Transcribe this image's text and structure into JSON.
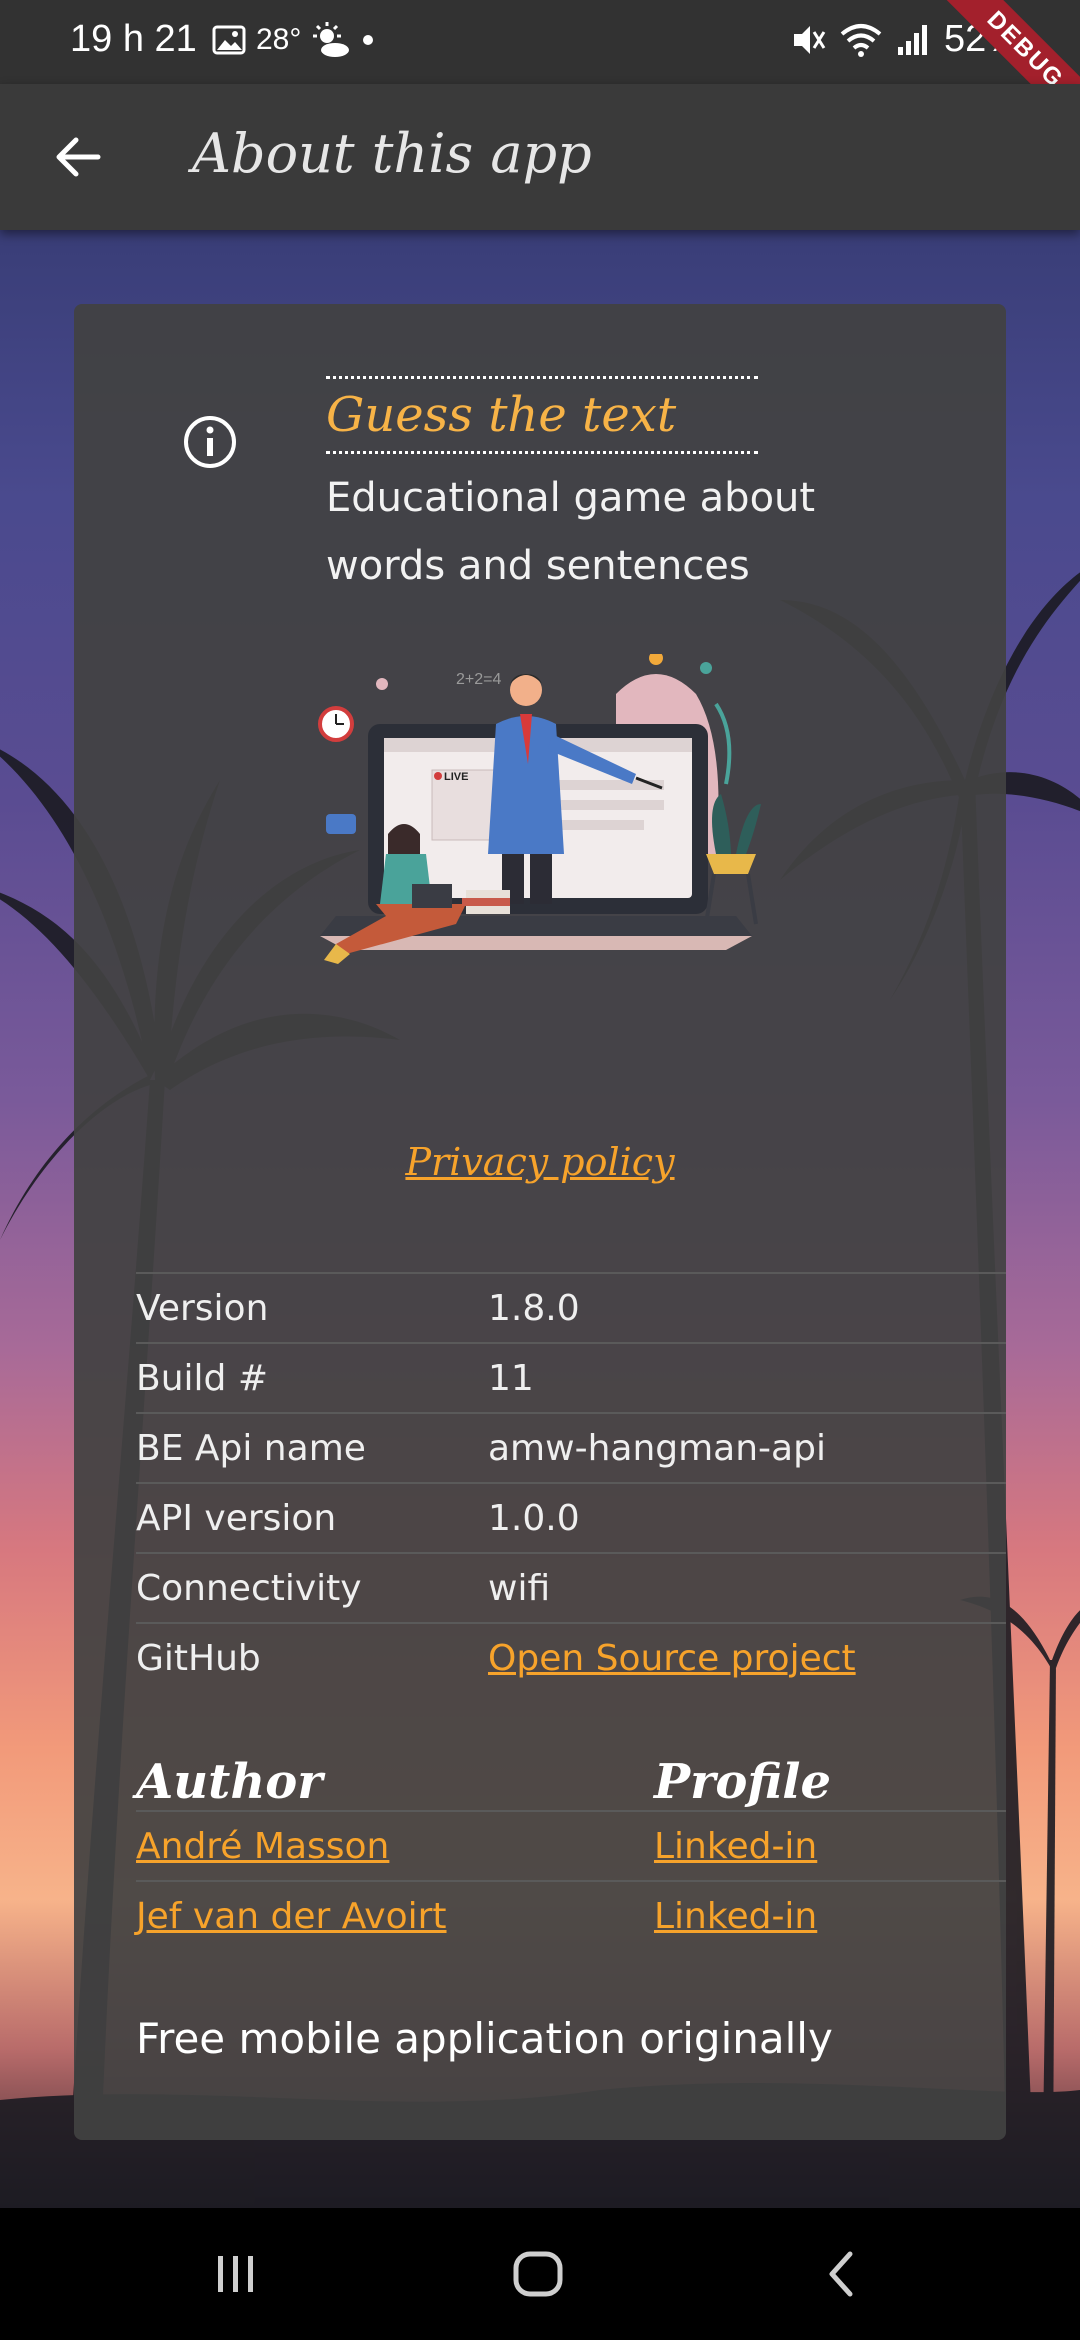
{
  "status_bar": {
    "time": "19 h 21",
    "temperature": "28°",
    "battery": "52%",
    "debug_label": "DEBUG"
  },
  "app_bar": {
    "title": "About this app"
  },
  "app_info": {
    "name": "Guess the text",
    "description": "Educational game about words and sentences",
    "privacy_link": "Privacy policy"
  },
  "details": {
    "rows": [
      {
        "label": "Version",
        "value": "1.8.0"
      },
      {
        "label": "Build #",
        "value": "11"
      },
      {
        "label": "BE Api name",
        "value": "amw-hangman-api"
      },
      {
        "label": "API version",
        "value": "1.0.0"
      },
      {
        "label": "Connectivity",
        "value": "wifi"
      },
      {
        "label": "GitHub",
        "value": "Open Source project"
      }
    ]
  },
  "authors": {
    "col_author": "Author",
    "col_profile": "Profile",
    "rows": [
      {
        "name": "André Masson",
        "profile": "Linked-in"
      },
      {
        "name": "Jef van der Avoirt",
        "profile": "Linked-in"
      }
    ]
  },
  "footer": {
    "text": "Free mobile application originally"
  },
  "illustration": {
    "live_label": "LIVE",
    "equation": "2+2=4"
  },
  "colors": {
    "accent": "#f7a32b",
    "card": "#424242",
    "app_bar": "#3a3a3a"
  }
}
